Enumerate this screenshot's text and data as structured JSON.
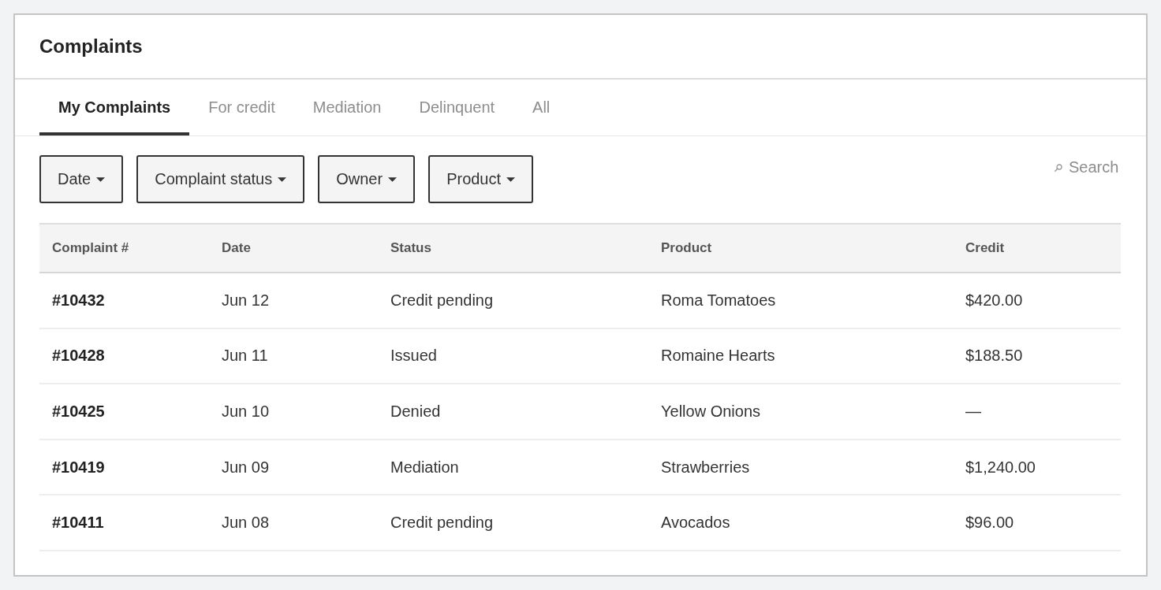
{
  "header": {
    "title": "Complaints"
  },
  "tabs": [
    {
      "label": "My Complaints",
      "selected": true
    },
    {
      "label": "For credit",
      "selected": false
    },
    {
      "label": "Mediation",
      "selected": false
    },
    {
      "label": "Delinquent",
      "selected": false
    },
    {
      "label": "All",
      "selected": false
    }
  ],
  "filters": [
    "Date",
    "Complaint status",
    "Owner",
    "Product"
  ],
  "search": {
    "placeholder": "Search"
  },
  "table": {
    "columns": [
      "Complaint #",
      "Date",
      "Status",
      "Product",
      "Credit"
    ],
    "rows": [
      [
        "#10432",
        "Jun 12",
        "Credit pending",
        "Roma Tomatoes",
        "$420.00"
      ],
      [
        "#10428",
        "Jun 11",
        "Issued",
        "Romaine Hearts",
        "$188.50"
      ],
      [
        "#10425",
        "Jun 10",
        "Denied",
        "Yellow Onions",
        "—"
      ],
      [
        "#10419",
        "Jun 09",
        "Mediation",
        "Strawberries",
        "$1,240.00"
      ],
      [
        "#10411",
        "Jun 08",
        "Credit pending",
        "Avocados",
        "$96.00"
      ]
    ]
  }
}
